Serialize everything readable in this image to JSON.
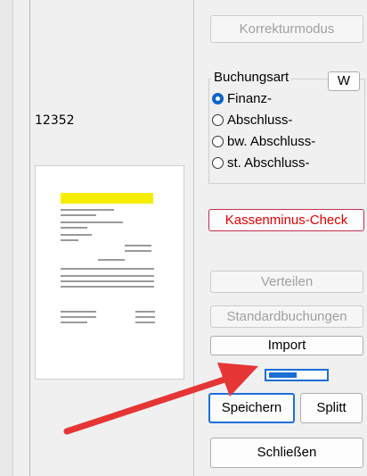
{
  "left": {
    "record_number": "12352"
  },
  "right": {
    "correction_mode_label": "Korrekturmodus",
    "booking_type": {
      "title": "Buchungsart",
      "w_button": "W",
      "options": [
        {
          "label": "Finanz-",
          "checked": true
        },
        {
          "label": "Abschluss-",
          "checked": false
        },
        {
          "label": "bw. Abschluss-",
          "checked": false
        },
        {
          "label": "st. Abschluss-",
          "checked": false
        }
      ]
    },
    "cash_minus_check_label": "Kassenminus-Check",
    "distribute_label": "Verteilen",
    "standard_bookings_label": "Standardbuchungen",
    "import_label": "Import",
    "progress_fraction": 0.5,
    "save_label": "Speichern",
    "split_label": "Splitt",
    "close_label": "Schließen"
  },
  "colors": {
    "accent": "#1a6fd3",
    "arrow": "#e53535",
    "warning_text": "#e00000",
    "thumbnail_highlight": "#f6ee00"
  }
}
